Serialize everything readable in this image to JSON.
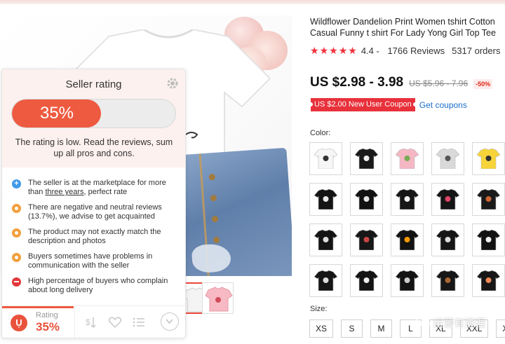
{
  "product": {
    "title": "Wildflower Dandelion Print Women tshirt Cotton Casual Funny t shirt For Lady Yong Girl Top Tee",
    "rating": "4.4",
    "reviews": "1766 Reviews",
    "orders": "5317 orders",
    "price": "US $2.98 - 3.98",
    "old_price": "US $5.96 - 7.96",
    "discount": "-50%",
    "coupon": "US $2.00 New User Coupon",
    "get_coupons": "Get coupons",
    "color_label": "Color:",
    "size_label": "Size:",
    "sizes": [
      "XS",
      "S",
      "M",
      "L",
      "XL",
      "XXL",
      "XXXL"
    ]
  },
  "panel": {
    "title": "Seller rating",
    "percent": "35%",
    "percent_value": 35,
    "description": "The rating is low. Read the reviews, sum up all pros and cons.",
    "items": [
      {
        "type": "info",
        "text_before": "The seller is at the marketplace for more than ",
        "underline": "three years",
        "text_after": ", perfect rate"
      },
      {
        "type": "warn",
        "text": "There are negative and neutral reviews (13.7%), we advise to get acquainted"
      },
      {
        "type": "warn",
        "text": "The product may not exactly match the description and photos"
      },
      {
        "type": "warn",
        "text": "Buyers sometimes have problems in communication with the seller"
      },
      {
        "type": "bad",
        "text": "High percentage of buyers who complain about long delivery"
      }
    ],
    "footer_label": "Rating",
    "footer_value": "35%"
  },
  "watermark": "运营有道理",
  "colors": {
    "accent": "#ee5a40",
    "star": "#f0313c",
    "coupon": "#e8313b",
    "link": "#1a6fc9",
    "info": "#3f9ae9",
    "warn": "#f29f3c",
    "bad": "#e2383a"
  },
  "icons": [
    "gear-icon",
    "star-icon",
    "info-icon",
    "warning-icon",
    "minus-icon",
    "logo-icon",
    "dollar-sort-icon",
    "heart-icon",
    "list-icon",
    "chevron-down-icon",
    "wechat-icon"
  ]
}
